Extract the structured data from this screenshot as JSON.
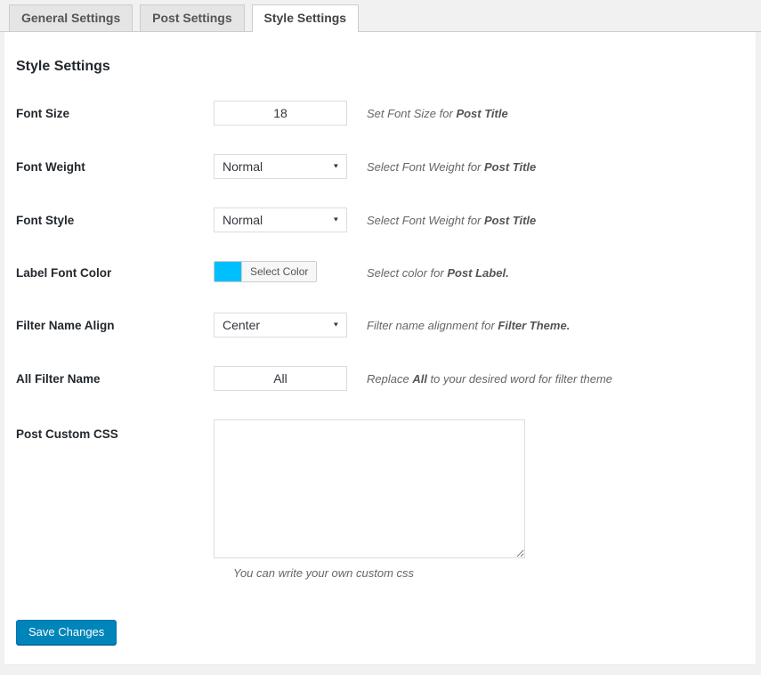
{
  "tabs": [
    {
      "label": "General Settings",
      "active": false
    },
    {
      "label": "Post Settings",
      "active": false
    },
    {
      "label": "Style Settings",
      "active": true
    }
  ],
  "heading": "Style Settings",
  "icons": {
    "select_arrow": "▼"
  },
  "colors": {
    "accent_blue": "#0085ba",
    "swatch_cyan": "#00bfff",
    "page_bg": "#f1f1f1",
    "panel_bg": "#ffffff"
  },
  "fields": [
    {
      "label": "Font Size",
      "type": "input",
      "value": "18",
      "desc": {
        "pre": "Set Font Size for ",
        "bold": "Post Title",
        "post": ""
      }
    },
    {
      "label": "Font Weight",
      "type": "select",
      "value": "Normal",
      "desc": {
        "pre": "Select Font Weight for ",
        "bold": "Post Title",
        "post": ""
      }
    },
    {
      "label": "Font Style",
      "type": "select",
      "value": "Normal",
      "desc": {
        "pre": "Select Font Weight for ",
        "bold": "Post Title",
        "post": ""
      }
    },
    {
      "label": "Label Font Color",
      "type": "color",
      "swatch_color": "#00bfff",
      "button_label": "Select Color",
      "desc": {
        "pre": "Select color for ",
        "bold": "Post Label.",
        "post": ""
      }
    },
    {
      "label": "Filter Name Align",
      "type": "select",
      "value": "Center",
      "desc": {
        "pre": "Filter name alignment for ",
        "bold": "Filter Theme.",
        "post": ""
      }
    },
    {
      "label": "All Filter Name",
      "type": "input",
      "value": "All",
      "desc": {
        "pre": "Replace ",
        "bold": "All",
        "post": " to your desired word for filter theme"
      }
    },
    {
      "label": "Post Custom CSS",
      "type": "textarea",
      "value": "",
      "desc": {
        "pre": "You can write your own custom css",
        "bold": "",
        "post": ""
      }
    }
  ],
  "save_button": {
    "label": "Save Changes"
  }
}
